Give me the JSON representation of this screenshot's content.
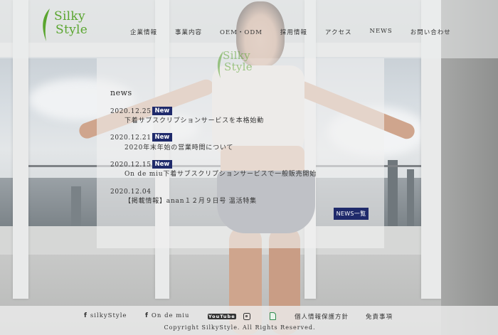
{
  "brand": {
    "logo_line1": "Silky",
    "logo_line2": "Style",
    "logo_color": "#5aa52f"
  },
  "nav": {
    "items": [
      "企業情報",
      "事業内容",
      "OEM・ODM",
      "採用情報",
      "アクセス",
      "NEWS",
      "お問い合わせ"
    ]
  },
  "news": {
    "heading": "news",
    "badge_label": "New",
    "items": [
      {
        "date": "2020.12.25",
        "is_new": true,
        "text": "下着サブスクリプションサービスを本格始動"
      },
      {
        "date": "2020.12.21",
        "is_new": true,
        "text": "2020年末年始の営業時間について"
      },
      {
        "date": "2020.12.15",
        "is_new": true,
        "text": "On de miu下着サブスクリプションサービスで一般販売開始"
      },
      {
        "date": "2020.12.04",
        "is_new": false,
        "text": "【掲載情報】anan１２月９日号 温活特集"
      }
    ],
    "more_button": "NEWS一覧",
    "accent_color": "#1f2a6b"
  },
  "footer": {
    "links": [
      {
        "label": "silkyStyle",
        "icon": "facebook-icon"
      },
      {
        "label": "On de miu",
        "icon": "facebook-icon"
      },
      {
        "label": "",
        "icon": "youtube-icon"
      },
      {
        "label": "",
        "icon": "instagram-icon"
      },
      {
        "label": "",
        "icon": "app-icon"
      },
      {
        "label": "個人情報保護方針",
        "icon": ""
      },
      {
        "label": "免責事項",
        "icon": ""
      }
    ],
    "youtube_glyph_text": "YouTube",
    "copyright": "Copyright SilkyStyle. All Rights Reserved."
  }
}
